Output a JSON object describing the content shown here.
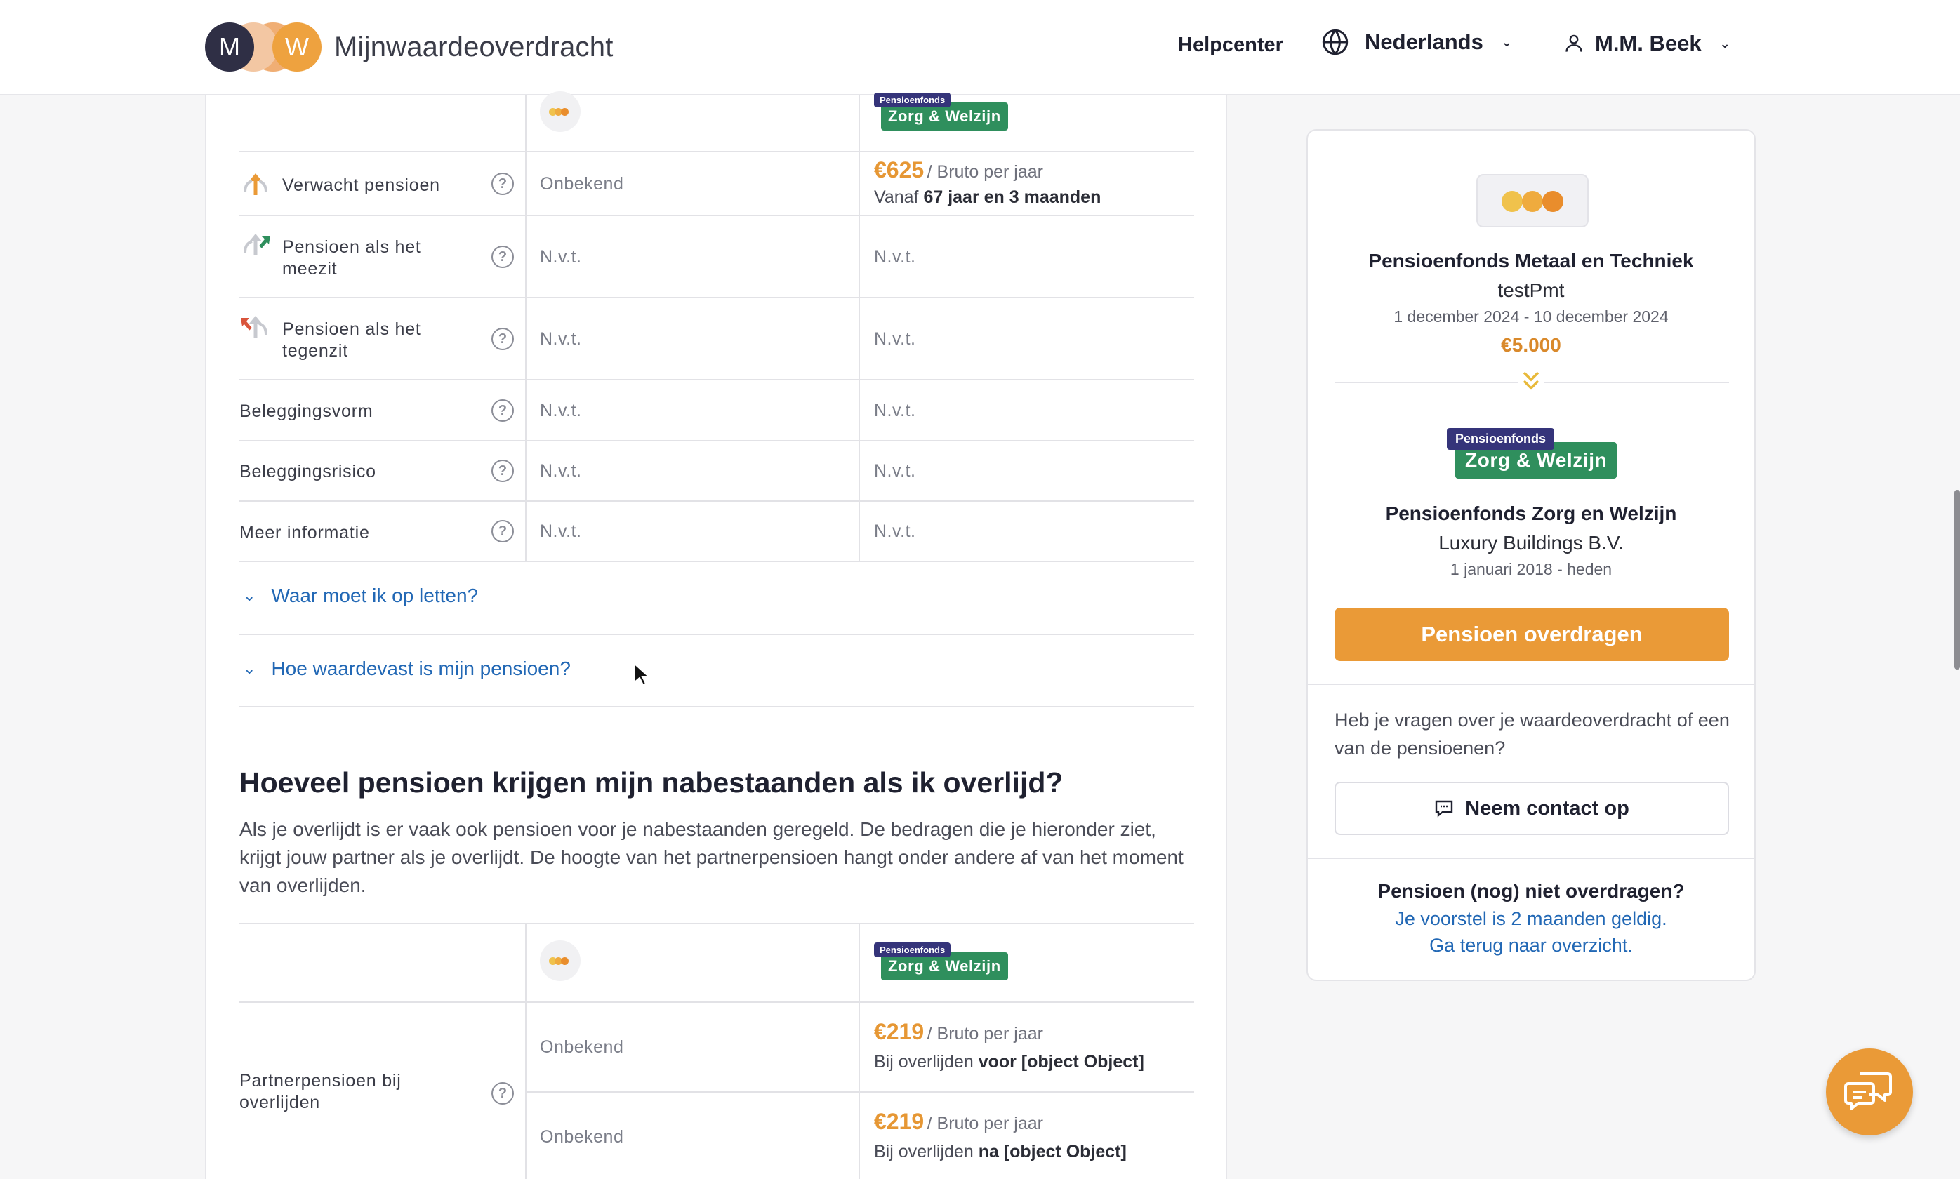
{
  "header": {
    "logo_initial_left": "M",
    "logo_initial_right": "W",
    "logo_text": "Mijnwaardeoverdracht",
    "help": "Helpcenter",
    "language": "Nederlands",
    "user": "M.M. Beek"
  },
  "table1": {
    "badge_top": "Pensioenfonds",
    "badge_main": "Zorg & Welzijn",
    "rows": [
      {
        "label": "Verwacht pensioen",
        "col1": "Onbekend",
        "amount": "€625",
        "unit": "/ Bruto per jaar",
        "sub_prefix": "Vanaf ",
        "sub_bold": "67 jaar en 3 maanden"
      },
      {
        "label_line1": "Pensioen als het",
        "label_line2": "meezit",
        "col1": "N.v.t.",
        "col2": "N.v.t."
      },
      {
        "label_line1": "Pensioen als het",
        "label_line2": "tegenzit",
        "col1": "N.v.t.",
        "col2": "N.v.t."
      },
      {
        "label": "Beleggingsvorm",
        "col1": "N.v.t.",
        "col2": "N.v.t."
      },
      {
        "label": "Beleggingsrisico",
        "col1": "N.v.t.",
        "col2": "N.v.t."
      },
      {
        "label": "Meer informatie",
        "col1": "N.v.t.",
        "col2": "N.v.t."
      }
    ],
    "help_glyph": "?"
  },
  "accordions": [
    "Waar moet ik op letten?",
    "Hoe waardevast is mijn pensioen?"
  ],
  "section2": {
    "title": "Hoeveel pensioen krijgen mijn nabestaanden als ik overlijd?",
    "body": "Als je overlijdt is er vaak ook pensioen voor je nabestaanden geregeld. De bedragen die je hieronder ziet, krijgt jouw partner als je overlijdt. De hoogte van het partnerpensioen hangt onder andere af van het moment van overlijden."
  },
  "table2": {
    "badge_top": "Pensioenfonds",
    "badge_main": "Zorg & Welzijn",
    "label_line1": "Partnerpensioen bij",
    "label_line2": "overlijden",
    "rows": [
      {
        "col1": "Onbekend",
        "amount": "€219",
        "unit": "/ Bruto per jaar",
        "sub_prefix": "Bij overlijden ",
        "sub_bold": "voor [object Object]"
      },
      {
        "col1": "Onbekend",
        "amount": "€219",
        "unit": "/ Bruto per jaar",
        "sub_prefix": "Bij overlijden ",
        "sub_bold": "na [object Object]"
      }
    ]
  },
  "sidebar": {
    "from_name": "Pensioenfonds Metaal en Techniek",
    "from_employer": "testPmt",
    "from_period": "1 december 2024 - 10 december 2024",
    "from_amount": "€5.000",
    "badge_top": "Pensioenfonds",
    "badge_main": "Zorg & Welzijn",
    "to_name": "Pensioenfonds Zorg en Welzijn",
    "to_employer": "Luxury Buildings B.V.",
    "to_period": "1 januari 2018 - heden",
    "cta": "Pensioen overdragen",
    "question": "Heb je vragen over je waardeoverdracht of een van de pensioenen?",
    "contact": "Neem contact op",
    "foot_title": "Pensioen (nog) niet overdragen?",
    "link1": "Je voorstel is 2 maanden geldig.",
    "link2": "Ga terug naar overzicht."
  },
  "colors": {
    "accent_orange": "#ea9a37",
    "link_blue": "#2268b5",
    "zw_green": "#2f8f5d",
    "zw_navy": "#35347a"
  },
  "icons": [
    "globe-icon",
    "user-icon",
    "chevron-down-icon",
    "help-circle-icon",
    "chat-icon",
    "double-chevron-down-icon"
  ]
}
